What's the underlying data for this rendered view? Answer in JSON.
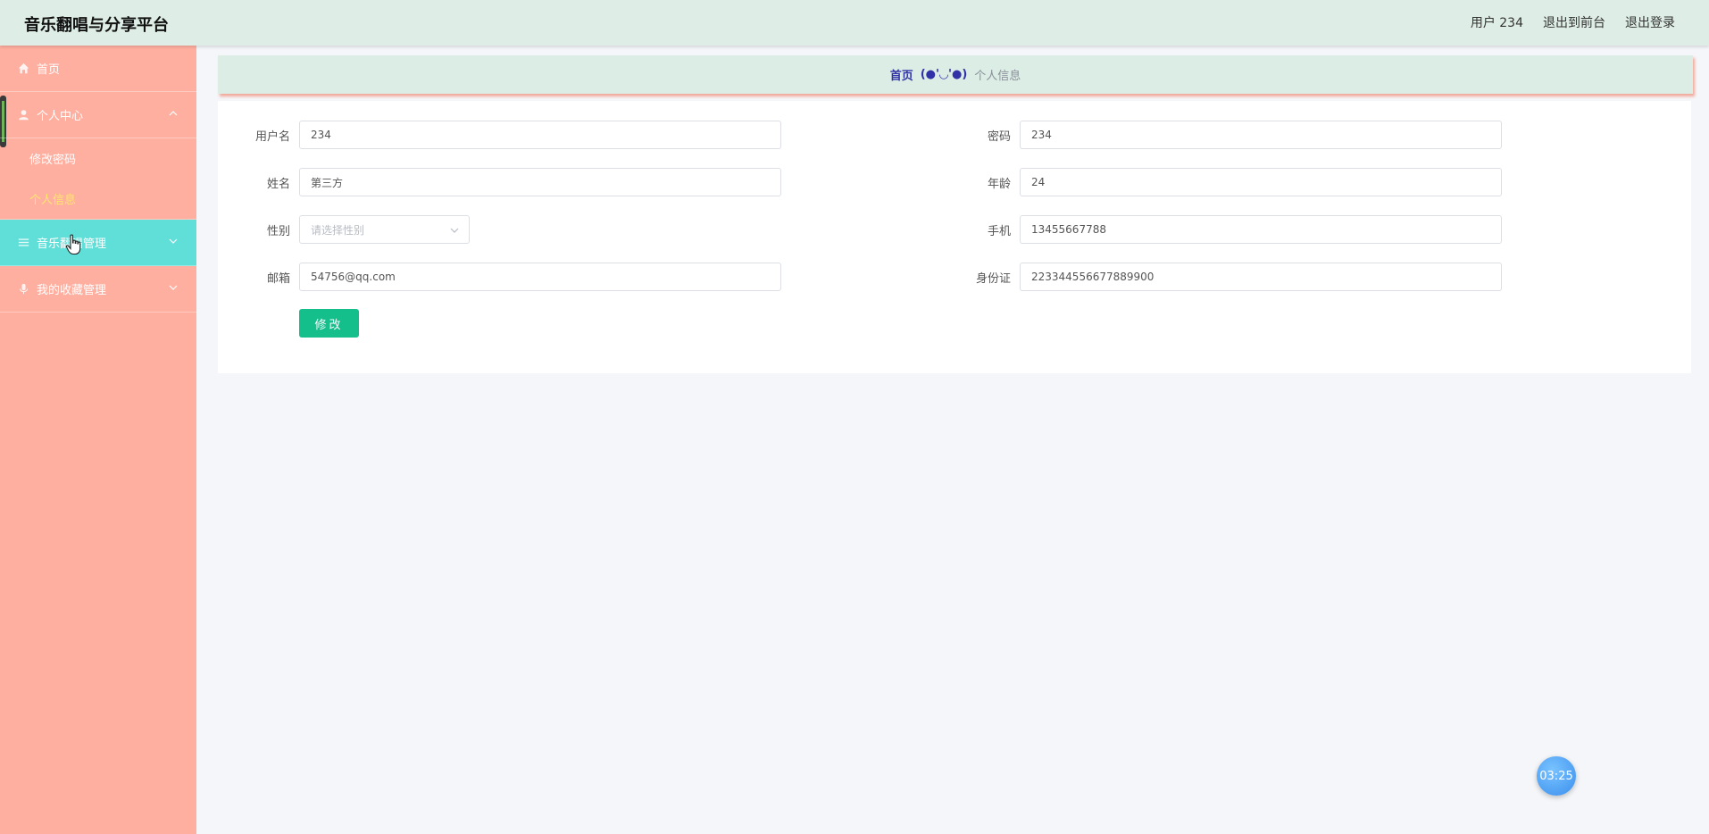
{
  "header": {
    "title": "音乐翻唱与分享平台",
    "user": "用户 234",
    "to_front": "退出到前台",
    "logout": "退出登录"
  },
  "sidebar": {
    "home": "首页",
    "personal_center": "个人中心",
    "change_password": "修改密码",
    "personal_info": "个人信息",
    "music_cover_mgmt": "音乐翻唱管理",
    "favorites_mgmt": "我的收藏管理"
  },
  "breadcrumb": {
    "home": "首页",
    "separator": "(●'◡'●)",
    "current": "个人信息"
  },
  "form": {
    "username_label": "用户名",
    "username": "234",
    "password_label": "密码",
    "password": "234",
    "name_label": "姓名",
    "name": "第三方",
    "age_label": "年龄",
    "age": "24",
    "gender_label": "性别",
    "gender_placeholder": "请选择性别",
    "phone_label": "手机",
    "phone": "13455667788",
    "email_label": "邮箱",
    "email": "54756@qq.com",
    "idcard_label": "身份证",
    "idcard": "223344556677889900",
    "submit": "修改"
  },
  "timer": "03:25",
  "colors": {
    "header_bg": "#deeee6",
    "sidebar_bg": "#ffafa0",
    "active_menu": "#5fdfd8",
    "current_sub": "#ffe66b",
    "submit_btn": "#15bf8c"
  }
}
